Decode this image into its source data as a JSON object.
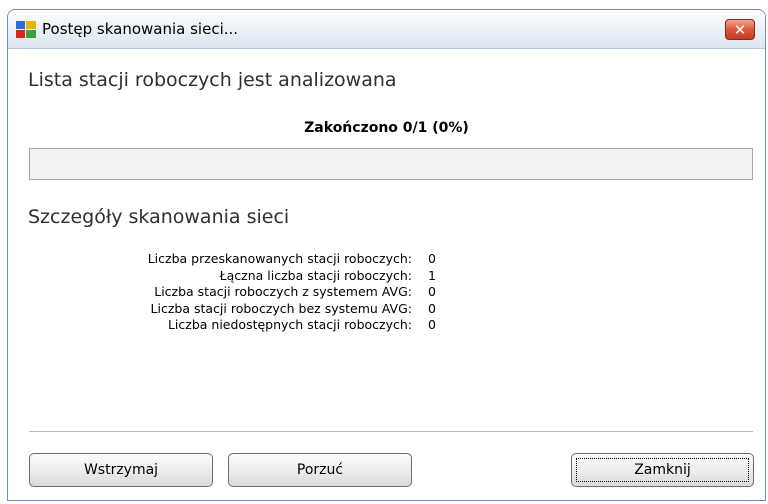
{
  "window": {
    "title": "Postęp skanowania sieci...",
    "icon": "avg-logo-icon",
    "close_glyph": "✕"
  },
  "main": {
    "heading": "Lista stacji roboczych jest analizowana",
    "status": "Zakończono 0/1 (0%)",
    "progress_fraction": 0
  },
  "details": {
    "heading": "Szczegóły skanowania sieci",
    "rows": [
      {
        "label": "Liczba przeskanowanych stacji roboczych:",
        "value": "0"
      },
      {
        "label": "Łączna liczba stacji roboczych:",
        "value": "1"
      },
      {
        "label": "Liczba stacji roboczych z systemem AVG:",
        "value": "0"
      },
      {
        "label": "Liczba stacji roboczych bez systemu AVG:",
        "value": "0"
      },
      {
        "label": "Liczba niedostępnych stacji roboczych:",
        "value": "0"
      }
    ]
  },
  "buttons": {
    "pause": "Wstrzymaj",
    "abort": "Porzuć",
    "close": "Zamknij"
  },
  "colors": {
    "close_button": "#d9482b",
    "progress_fill": "#3d8ee0"
  }
}
